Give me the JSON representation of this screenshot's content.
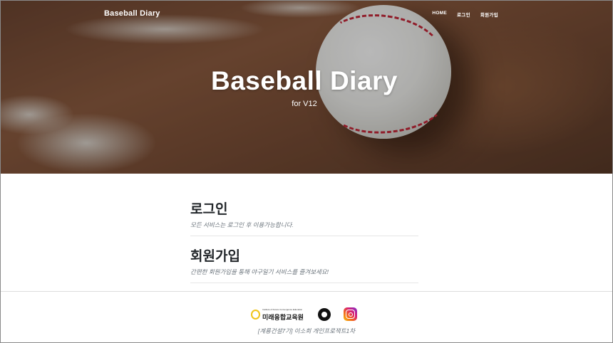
{
  "nav": {
    "brand": "Baseball Diary",
    "links": [
      "HOME",
      "로그인",
      "회원가입"
    ]
  },
  "hero": {
    "title": "Baseball Diary",
    "subtitle": "for V12"
  },
  "sections": [
    {
      "title": "로그인",
      "description": "모든 서비스는 로그인 후 이용가능합니다."
    },
    {
      "title": "회원가입",
      "description": "간편한 회원가입을 통해 야구일기 서비스를 즐겨보세요!"
    }
  ],
  "footer": {
    "logo_small_text": "Institute of Future Convergence Education",
    "logo_text": "미래융합교육원",
    "icons": [
      "github-icon",
      "instagram-icon"
    ],
    "credit": "[계룡건설7기] 이소희 개인프로젝트1차"
  },
  "colors": {
    "accent": "#212529",
    "muted": "#6c757d",
    "logo_yellow": "#f0c419",
    "instagram_pink": "#d51f77"
  }
}
